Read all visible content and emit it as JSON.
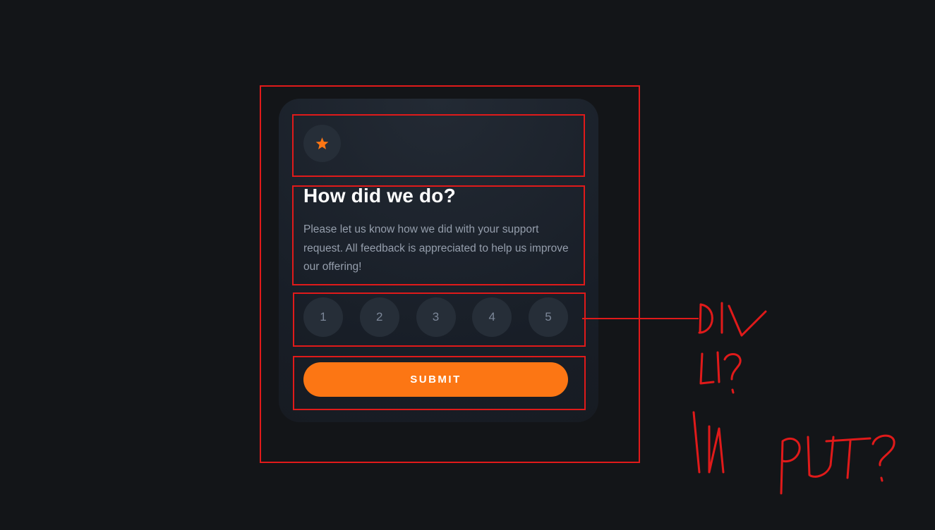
{
  "card": {
    "icon": "star-icon",
    "title": "How did we do?",
    "description": "Please let us know how we did with your support request. All feedback is appreciated to help us improve our offering!",
    "ratings": [
      "1",
      "2",
      "3",
      "4",
      "5"
    ],
    "submit_label": "SUBMIT"
  },
  "annotation": {
    "notes": [
      "DIV",
      "LI?",
      "INPUT?"
    ]
  },
  "colors": {
    "accent": "#fc7614",
    "annotation": "#e01a1a",
    "background": "#131518",
    "card": "#1b212a"
  }
}
